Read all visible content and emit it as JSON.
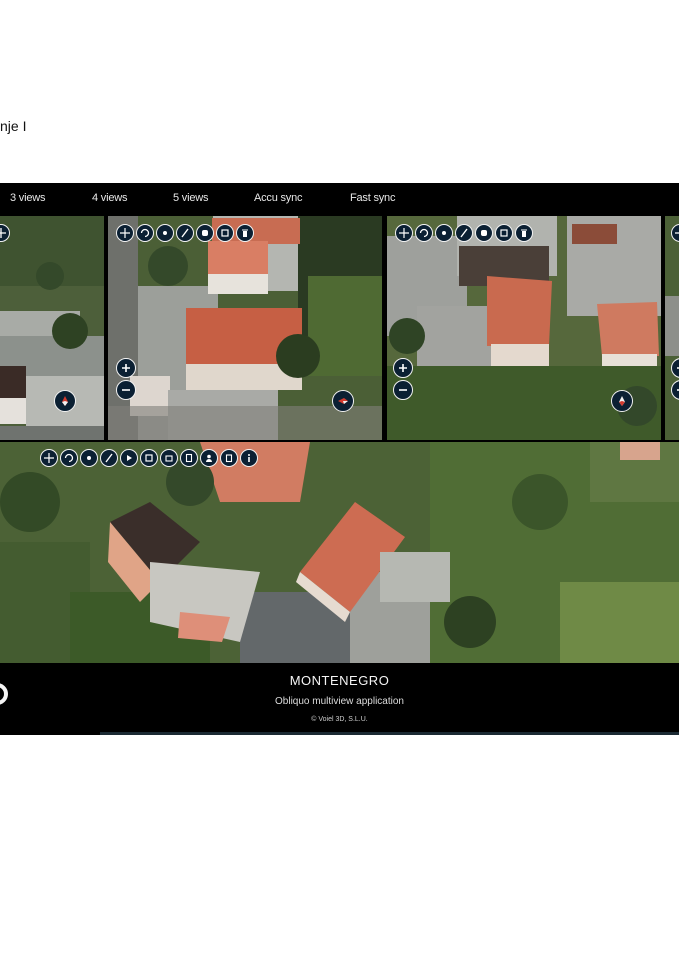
{
  "page": {
    "heading": "nje I"
  },
  "tabs": [
    {
      "label": "3 views"
    },
    {
      "label": "4 views"
    },
    {
      "label": "5 views"
    },
    {
      "label": "Accu sync"
    },
    {
      "label": "Fast sync"
    }
  ],
  "footer": {
    "title": "MONTENEGRO",
    "subtitle": "Obliquo multiview application",
    "copyright": "© Voiel 3D, S.L.U."
  },
  "colors": {
    "roof": "#c8664e",
    "grass": "#3e5530",
    "pavement": "#8f9490",
    "button_fill": "#0b2033"
  },
  "icons": {
    "small_view_tools": [
      "move-icon",
      "rotate-icon",
      "dot-icon",
      "pencil-icon",
      "hand-icon",
      "crop-icon",
      "trash-icon"
    ],
    "main_view_tools": [
      "move-icon",
      "rotate-icon",
      "dot-icon",
      "pencil-icon",
      "play-icon",
      "crop-icon",
      "building-icon",
      "document-icon",
      "person-icon",
      "copy-icon",
      "info-icon"
    ]
  }
}
